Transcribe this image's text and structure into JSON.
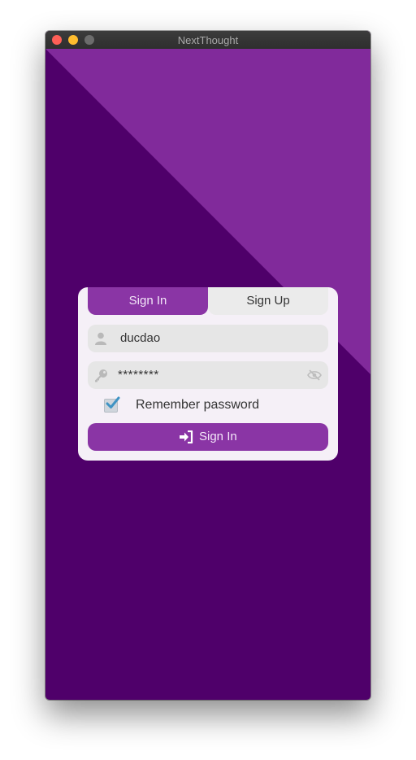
{
  "window": {
    "title": "NextThought"
  },
  "colors": {
    "background_dark": "#4f006a",
    "background_light": "#812a9b",
    "accent": "#8a35a5",
    "card": "#f5f0f7"
  },
  "tabs": [
    {
      "label": "Sign In",
      "active": true
    },
    {
      "label": "Sign Up",
      "active": false
    }
  ],
  "form": {
    "username": {
      "value": "ducdao",
      "icon": "user-icon"
    },
    "password": {
      "value": "********",
      "icon": "key-icon",
      "toggle_icon": "eye-slash-icon"
    },
    "remember": {
      "label": "Remember password",
      "checked": true
    },
    "submit": {
      "label": "Sign In",
      "icon": "sign-in-icon"
    }
  }
}
